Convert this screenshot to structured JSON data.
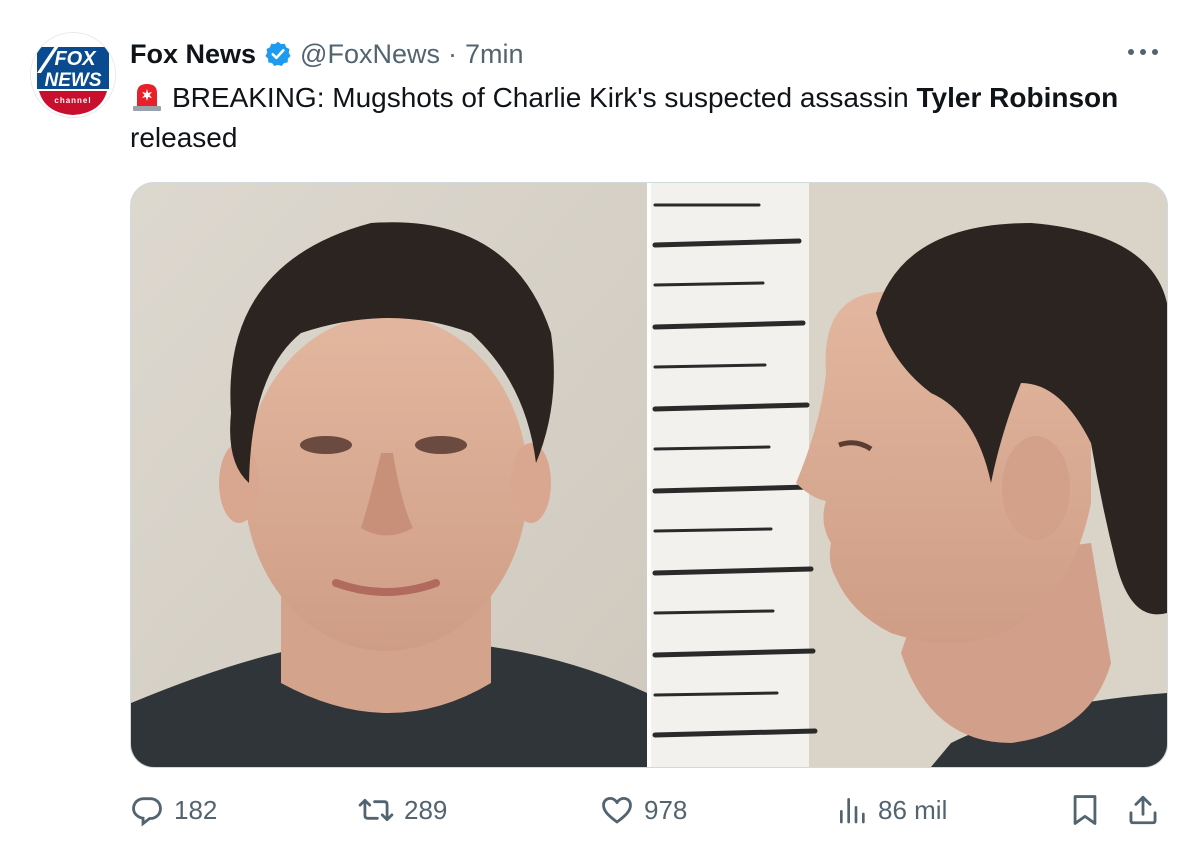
{
  "tweet": {
    "author": {
      "display_name": "Fox News",
      "handle": "@FoxNews",
      "separator": "·",
      "time": "7min",
      "verified": true,
      "avatar_icon": "fox-news-channel-logo",
      "avatar_text": {
        "line1": "FOX",
        "line2": "NEWS",
        "line3": "channel"
      }
    },
    "text": {
      "emoji_icon": "police-siren-icon",
      "body": "BREAKING: Mugshots of Charlie Kirk's suspected assassin ",
      "bold": "Tyler Robinson",
      "tail": " released"
    },
    "media": {
      "images": [
        "front-facing mugshot",
        "profile mugshot with height chart"
      ]
    },
    "stats": {
      "replies": "182",
      "reposts": "289",
      "likes": "978",
      "views": "86 mil"
    },
    "icons": {
      "reply": "reply-icon",
      "repost": "repost-icon",
      "like": "like-icon",
      "views": "views-icon",
      "bookmark": "bookmark-icon",
      "share": "share-icon",
      "more": "more-icon"
    },
    "colors": {
      "text": "#0f1419",
      "secondary": "#536471",
      "verified": "#1d9bf0",
      "fox_blue": "#0a4a8f",
      "fox_red": "#c8102e"
    }
  }
}
